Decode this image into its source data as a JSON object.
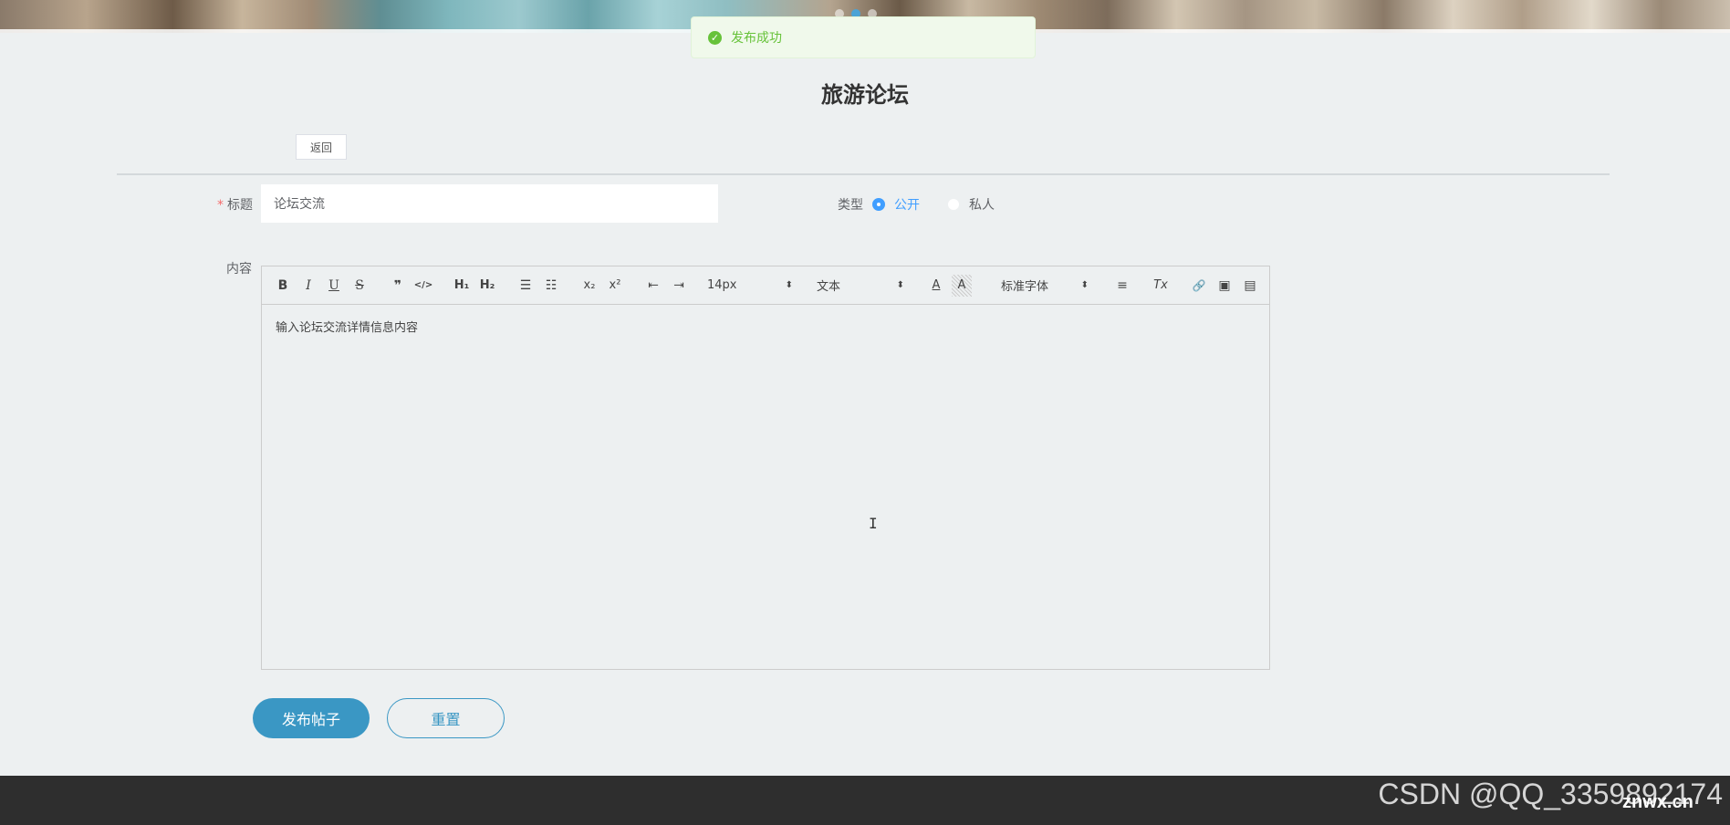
{
  "toast": {
    "message": "发布成功"
  },
  "page": {
    "title": "旅游论坛"
  },
  "back_label": "返回",
  "form": {
    "title_label": "标题",
    "title_value": "论坛交流",
    "type_label": "类型",
    "type_options": [
      "公开",
      "私人"
    ],
    "type_selected": "公开",
    "content_label": "内容"
  },
  "editor": {
    "toolbar": {
      "bold": "B",
      "italic": "I",
      "underline": "U",
      "strike": "S",
      "blockquote": "❞",
      "code": "</>",
      "h1": "H₁",
      "h2": "H₂",
      "ordered_list": "☰",
      "bullet_list": "☷",
      "subscript": "x₂",
      "superscript": "x²",
      "outdent": "⇤",
      "indent": "⇥",
      "size": "14px",
      "header": "文本",
      "color": "A",
      "background": "A",
      "font": "标准字体",
      "align": "≡",
      "clean": "Tx",
      "link": "🔗",
      "image": "▣",
      "video": "▤",
      "picker_arrow": "⬍"
    },
    "content": "输入论坛交流详情信息内容"
  },
  "buttons": {
    "submit": "发布帖子",
    "reset": "重置"
  },
  "watermark": {
    "csdn": "CSDN @QQ_3359892174",
    "site": "znwx.cn"
  }
}
